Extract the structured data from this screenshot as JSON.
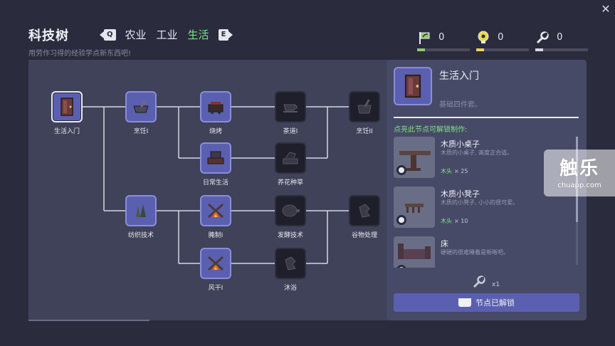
{
  "close_icon": "close-icon",
  "header": {
    "title": "科技树",
    "subtitle": "用劳作习得的经验学点新东西吧!",
    "key_prev": "Q",
    "key_next": "E",
    "tabs": [
      {
        "label": "农业",
        "active": false
      },
      {
        "label": "工业",
        "active": false
      },
      {
        "label": "生活",
        "active": true
      }
    ]
  },
  "resources": [
    {
      "icon": "leaf-flag-icon",
      "value": "0",
      "color": "#8fc96a",
      "fill": 0.15
    },
    {
      "icon": "gear-bulb-icon",
      "value": "0",
      "color": "#e8d84a",
      "fill": 0.15
    },
    {
      "icon": "wrench-icon",
      "value": "0",
      "color": "#d8d8e0",
      "fill": 0.15
    }
  ],
  "tree": {
    "nodes": [
      {
        "id": "n1",
        "label": "生活入门",
        "state": "selected",
        "icon": "door-icon"
      },
      {
        "id": "n2",
        "label": "烹饪I",
        "state": "unlocked",
        "icon": "mortar-icon"
      },
      {
        "id": "n3",
        "label": "烧烤",
        "state": "unlocked",
        "icon": "grill-icon"
      },
      {
        "id": "n4",
        "label": "茶道I",
        "state": "locked",
        "icon": "tea-icon"
      },
      {
        "id": "n5",
        "label": "烹饪II",
        "state": "locked",
        "icon": "pot-icon"
      },
      {
        "id": "n6",
        "label": "日常生活",
        "state": "unlocked",
        "icon": "daily-icon"
      },
      {
        "id": "n7",
        "label": "养花种草",
        "state": "locked",
        "icon": "plant-icon"
      },
      {
        "id": "n8",
        "label": "纺织技术",
        "state": "unlocked",
        "icon": "loom-icon"
      },
      {
        "id": "n9",
        "label": "腌制I",
        "state": "unlocked",
        "icon": "fire-icon"
      },
      {
        "id": "n10",
        "label": "发酵技术",
        "state": "locked",
        "icon": "barrel-icon"
      },
      {
        "id": "n11",
        "label": "谷物处理",
        "state": "locked",
        "icon": "grain-icon"
      },
      {
        "id": "n12",
        "label": "风干I",
        "state": "unlocked",
        "icon": "dry-fire-icon"
      },
      {
        "id": "n13",
        "label": "沐浴",
        "state": "locked",
        "icon": "bath-icon"
      }
    ]
  },
  "detail": {
    "title": "生活入门",
    "description": "基础四件套。",
    "unlock_heading": "点亮此节点可解锁制作:",
    "recipes": [
      {
        "name": "木质小桌子",
        "desc": "木质的小桌子, 高度正合适。",
        "material": "木头",
        "qty": "× 25"
      },
      {
        "name": "木质小凳子",
        "desc": "木质的小凳子, 小小的很可爱。",
        "material": "木头",
        "qty": "× 10"
      },
      {
        "name": "床",
        "desc": "硬硬的很难睡着是新晰吧。",
        "material": "",
        "qty": ""
      }
    ],
    "cost_icon": "wrench-icon",
    "cost_value": "x1",
    "button_label": "节点已解锁"
  },
  "watermark": {
    "logo": "触乐",
    "url": "chuapp.com"
  }
}
